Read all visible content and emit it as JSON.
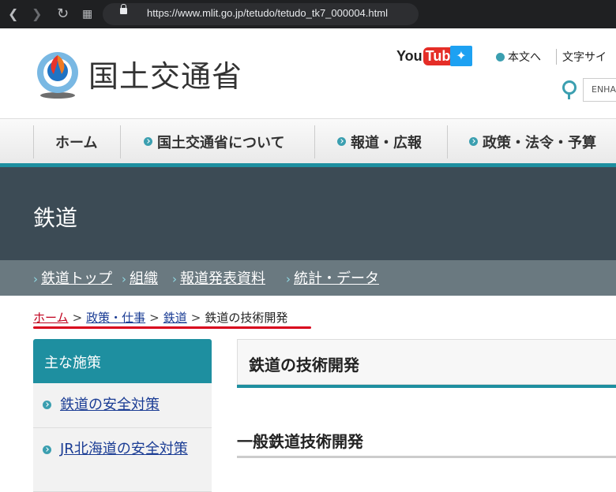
{
  "browser": {
    "url": "https://www.mlit.go.jp/tetudo/tetudo_tk7_000004.html"
  },
  "header": {
    "site_name": "国土交通省",
    "youtube_you": "You",
    "youtube_tube": "Tube",
    "skip_link": "本文へ",
    "font_size_label": "文字サイ",
    "search_value": "ENHA"
  },
  "global_nav": [
    {
      "label": "ホーム"
    },
    {
      "label": "国土交通省について"
    },
    {
      "label": "報道・広報"
    },
    {
      "label": "政策・法令・予算"
    }
  ],
  "banner": {
    "title": "鉄道"
  },
  "sub_nav": [
    {
      "label": "鉄道トップ"
    },
    {
      "label": "組織"
    },
    {
      "label": "報道発表資料"
    },
    {
      "label": "統計・データ"
    }
  ],
  "breadcrumb": {
    "items": [
      "ホーム",
      "政策・仕事",
      "鉄道"
    ],
    "current": "鉄道の技術開発",
    "separator": ">"
  },
  "sidebar": {
    "heading": "主な施策",
    "links": [
      "鉄道の安全対策",
      "JR北海道の安全対策"
    ]
  },
  "main": {
    "title": "鉄道の技術開発",
    "section_title": "一般鉄道技術開発"
  },
  "colors": {
    "accent": "#1e8fa0",
    "banner": "#3c4b55",
    "subnav": "#6a7980",
    "highlight": "#d8001c"
  }
}
